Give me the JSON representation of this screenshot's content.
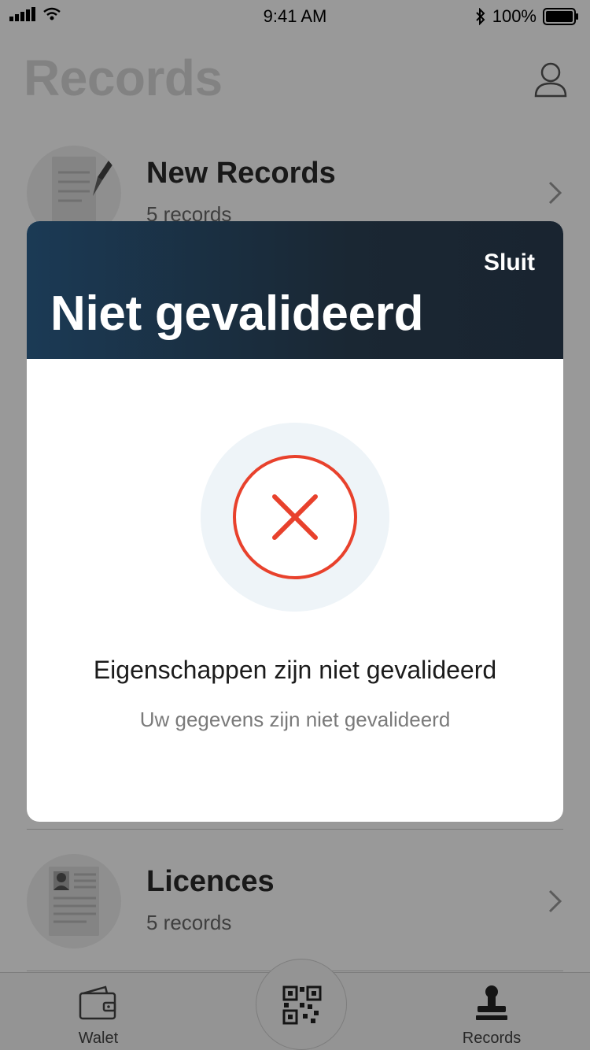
{
  "status_bar": {
    "time": "9:41 AM",
    "battery": "100%"
  },
  "nav": {
    "title": "Records",
    "profile_icon": "user-icon"
  },
  "list": {
    "items": [
      {
        "title": "New Records",
        "subtitle": "5 records",
        "icon": "document-pen-icon"
      },
      {
        "title": "Licences",
        "subtitle": "5 records",
        "icon": "id-card-icon"
      }
    ]
  },
  "tabbar": {
    "tabs": [
      {
        "label": "Walet",
        "icon": "wallet-icon"
      },
      {
        "label": "",
        "icon": "qr-code-icon"
      },
      {
        "label": "Records",
        "icon": "stamp-icon"
      }
    ]
  },
  "modal": {
    "close_label": "Sluit",
    "title": "Niet gevalideerd",
    "message_title": "Eigenschappen zijn niet gevalideerd",
    "message_subtitle": "Uw gegevens zijn niet gevalideerd",
    "status_icon": "error-x-icon",
    "colors": {
      "header_dark": "#1a2733",
      "header_accent": "#1b3a55",
      "error": "#e8412c",
      "circle_bg": "#eef4f8"
    }
  }
}
